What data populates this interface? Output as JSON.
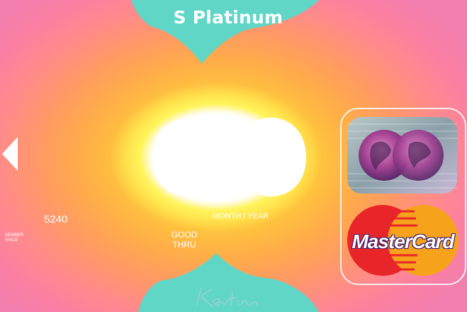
{
  "card": {
    "brand": "S Platinum",
    "account_prefix": "5240",
    "member_since_line1": "MEMBER",
    "member_since_line2": "SINCE",
    "good_thru_line1": "GOOD",
    "good_thru_line2": "THRU",
    "month_year": "MONTH / YEAR",
    "network_logo_text": "MasterCard",
    "signature": "Karin",
    "colors": {
      "teal_band": "#5fd6c6",
      "glow_center": "#ffffff",
      "glow_yellow": "#fff34a",
      "edge_pink": "#f27fae",
      "mc_red": "#e8262a",
      "mc_orange": "#f7a21b"
    },
    "icons": [
      "left-arrow-icon",
      "hologram-globe-icon",
      "mastercard-logo-icon"
    ]
  }
}
